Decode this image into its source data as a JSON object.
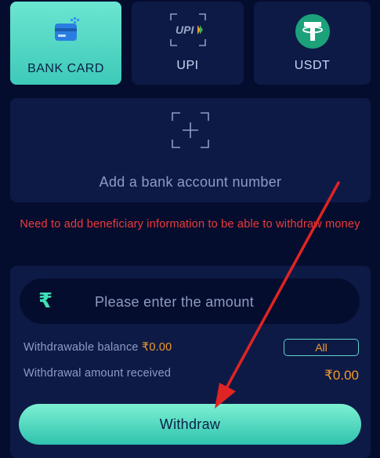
{
  "methods": [
    {
      "label": "BANK CARD",
      "icon": "bank-card-icon",
      "active": true
    },
    {
      "label": "UPI",
      "icon": "upi-logo",
      "active": false
    },
    {
      "label": "USDT",
      "icon": "tether-icon",
      "active": false
    }
  ],
  "add_account": {
    "text": "Add a bank account number",
    "icon": "add-icon"
  },
  "warning": "Need to add beneficiary information to be able to withdraw money",
  "amount": {
    "placeholder": "Please enter the amount",
    "currency_symbol": "₹"
  },
  "balance": {
    "label": "Withdrawable balance",
    "value": "₹0.00",
    "all_label": "All"
  },
  "received": {
    "label": "Withdrawal amount received",
    "value": "₹0.00"
  },
  "withdraw_label": "Withdraw",
  "colors": {
    "accent": "#4fd8c2",
    "background": "#050d2e",
    "panel": "#0d1a46",
    "warning": "#ee3b3b",
    "amount": "#f39b2b",
    "arrow": "#e02424"
  }
}
